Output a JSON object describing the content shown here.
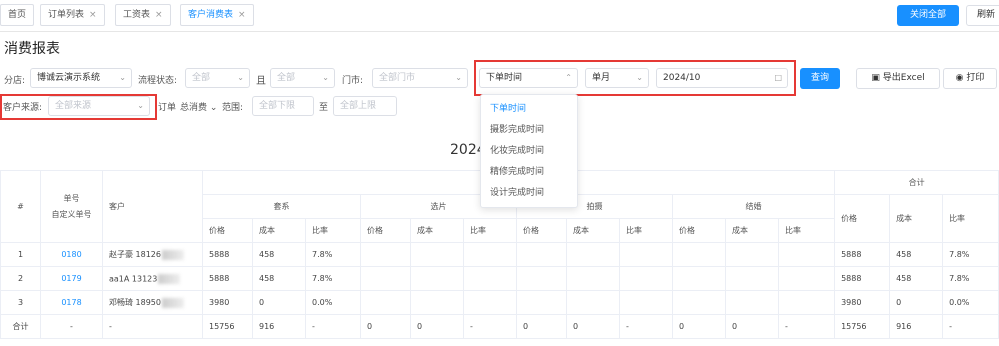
{
  "tabs": [
    {
      "label": "首页",
      "closable": false,
      "active": false
    },
    {
      "label": "订单列表",
      "closable": true,
      "active": false
    },
    {
      "label": "工资表",
      "closable": true,
      "active": false
    },
    {
      "label": "客户消费表",
      "closable": true,
      "active": true
    }
  ],
  "tab_close_glyph": "×",
  "topbar": {
    "close_all": "关闭全部",
    "refresh": "刷新"
  },
  "page_title": "消费报表",
  "filters": {
    "branch_label": "分店:",
    "branch_value": "博诚云演示系统",
    "flow_label": "流程状态:",
    "flow_value": "全部",
    "and_label": "且",
    "flow2_value": "全部",
    "store_label": "门市:",
    "store_placeholder": "全部门市",
    "time_type_value": "下单时间",
    "period_value": "单月",
    "date_value": "2024/10",
    "query": "查询",
    "export": "导出Excel",
    "print": "打印",
    "source_label": "客户来源:",
    "source_placeholder": "全部来源",
    "order_label": "订单",
    "total_label": "总消费",
    "range_label": "范围:",
    "range_min_placeholder": "全部下限",
    "range_to": "至",
    "range_max_placeholder": "全部上限"
  },
  "time_type_options": [
    "下单时间",
    "摄影完成时间",
    "化妆完成时间",
    "精修完成时间",
    "设计完成时间"
  ],
  "report_title": "2024",
  "table": {
    "header": {
      "index": "#",
      "order_no": "单号",
      "custom_no": "自定义单号",
      "customer": "客户",
      "total": "合计",
      "groups": [
        "套系",
        "选片",
        "拍摄",
        "结婚"
      ],
      "sub": [
        "价格",
        "成本",
        "比率"
      ]
    },
    "rows": [
      {
        "idx": "1",
        "no": "0180",
        "customer": "赵子豪 18126",
        "cells": [
          "5888",
          "458",
          "7.8%",
          "",
          "",
          "",
          "",
          "",
          "",
          "",
          "",
          ""
        ],
        "total": [
          "5888",
          "458",
          "7.8%"
        ]
      },
      {
        "idx": "2",
        "no": "0179",
        "customer": "aa1A 13123",
        "cells": [
          "5888",
          "458",
          "7.8%",
          "",
          "",
          "",
          "",
          "",
          "",
          "",
          "",
          ""
        ],
        "total": [
          "5888",
          "458",
          "7.8%"
        ]
      },
      {
        "idx": "3",
        "no": "0178",
        "customer": "邓畅琦 18950",
        "cells": [
          "3980",
          "0",
          "0.0%",
          "",
          "",
          "",
          "",
          "",
          "",
          "",
          "",
          ""
        ],
        "total": [
          "3980",
          "0",
          "0.0%"
        ]
      }
    ],
    "sum_row": {
      "label": "合计",
      "no": "-",
      "customer": "-",
      "cells": [
        "15756",
        "916",
        "-",
        "0",
        "0",
        "-",
        "0",
        "0",
        "-",
        "0",
        "0",
        "-"
      ],
      "total": [
        "15756",
        "916",
        "-"
      ]
    }
  },
  "icons": {
    "export": "export-icon",
    "print": "printer-icon",
    "calendar": "calendar-icon",
    "chevron": "chevron-down-icon"
  },
  "colors": {
    "primary": "#1890ff",
    "highlight_box": "#e53935"
  }
}
